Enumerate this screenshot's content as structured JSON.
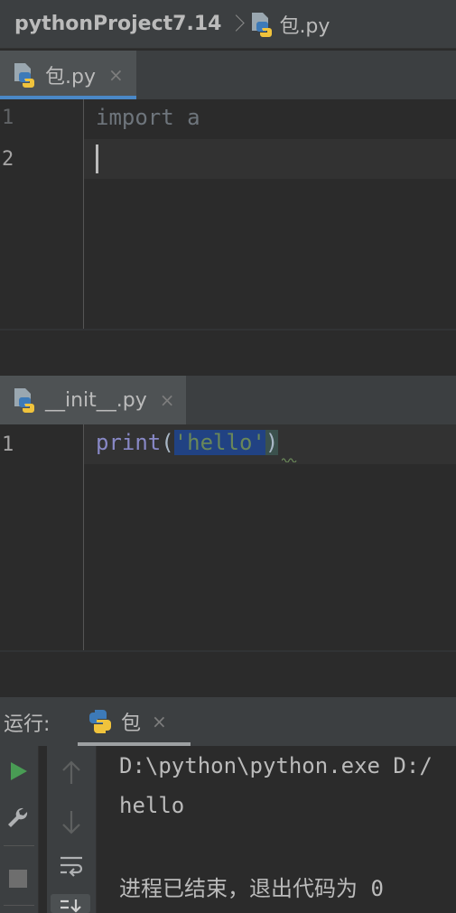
{
  "breadcrumb": {
    "project": "pythonProject7.14",
    "file": "包.py"
  },
  "editor1": {
    "tab_label": "包.py",
    "close_glyph": "×",
    "line_numbers": [
      "1",
      "2"
    ],
    "code": {
      "keyword": "import",
      "name": "a"
    }
  },
  "editor2": {
    "tab_label": "__init__.py",
    "close_glyph": "×",
    "line_numbers": [
      "1"
    ],
    "code": {
      "func": "print",
      "open": "(",
      "string": "'hello'",
      "close": ")"
    }
  },
  "run": {
    "label": "运行:",
    "tab_label": "包",
    "close_glyph": "×",
    "output": [
      "D:\\python\\python.exe D:/",
      "hello",
      "",
      "进程已结束，退出代码为 0"
    ]
  },
  "colors": {
    "keyword_dim": "#6e757c",
    "builtin": "#8888c6",
    "string": "#6a8759",
    "selection": "#214283",
    "run_green": "#499c54"
  }
}
